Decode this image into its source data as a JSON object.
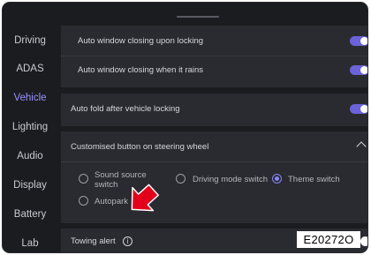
{
  "sidebar": {
    "items": [
      {
        "label": "Driving"
      },
      {
        "label": "ADAS"
      },
      {
        "label": "Vehicle"
      },
      {
        "label": "Lighting"
      },
      {
        "label": "Audio"
      },
      {
        "label": "Display"
      },
      {
        "label": "Battery"
      },
      {
        "label": "Lab"
      }
    ],
    "active_item": "Vehicle"
  },
  "settings": {
    "auto_window_locking": {
      "label": "Auto window closing upon locking",
      "enabled": true
    },
    "auto_window_rain": {
      "label": "Auto window closing when it rains",
      "enabled": true
    },
    "auto_fold": {
      "label": "Auto fold after vehicle locking",
      "enabled": true
    },
    "customised_button": {
      "label": "Customised button on steering wheel",
      "expanded": true,
      "options": [
        {
          "label": "Sound source switch",
          "selected": false
        },
        {
          "label": "Driving mode switch",
          "selected": false
        },
        {
          "label": "Theme switch",
          "selected": true
        },
        {
          "label": "Autopark",
          "selected": false
        }
      ]
    },
    "towing_alert": {
      "label": "Towing alert",
      "info_icon": "info-icon"
    }
  },
  "watermark": "E20272O",
  "colors": {
    "accent": "#6b63d9",
    "background": "#1b1c20",
    "panel": "#2a2b30",
    "arrow": "#e3001b"
  }
}
